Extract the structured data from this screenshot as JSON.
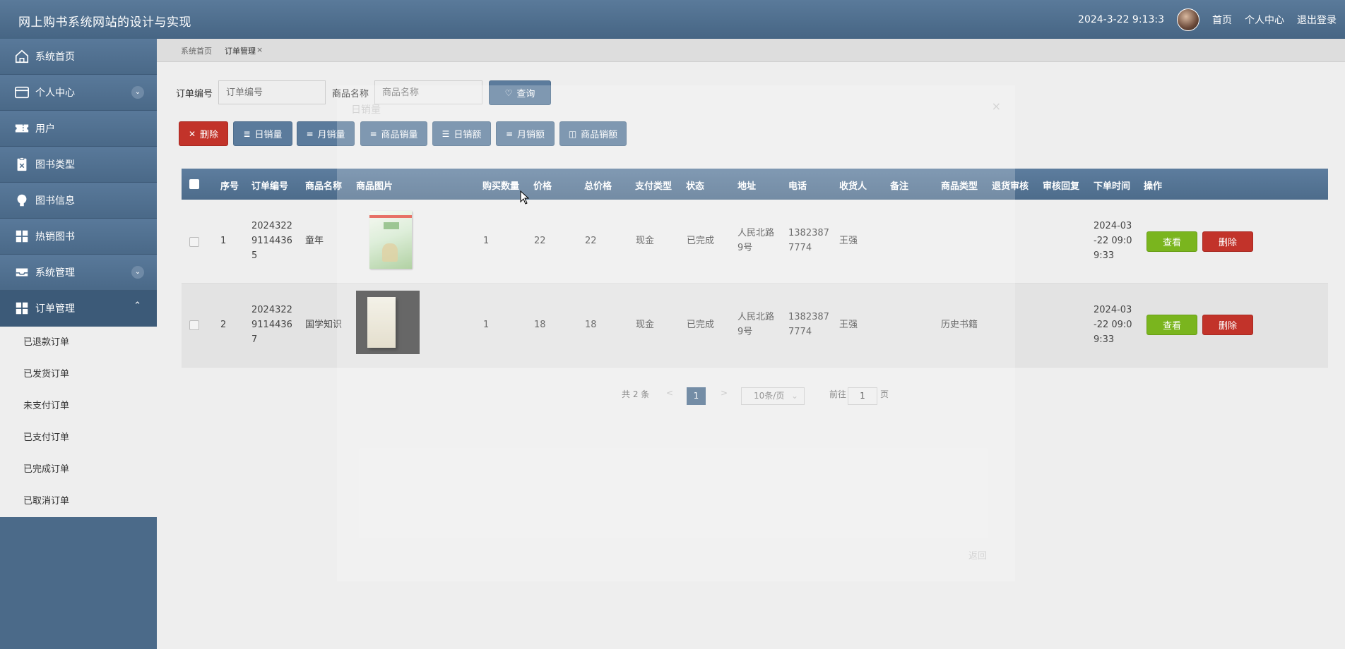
{
  "header": {
    "title": "网上购书系统网站的设计与实现",
    "datetime": "2024-3-22 9:13:3",
    "links": [
      "首页",
      "个人中心",
      "退出登录"
    ]
  },
  "sidebar": {
    "items": [
      {
        "label": "系统首页",
        "icon": "home-icon"
      },
      {
        "label": "个人中心",
        "icon": "card-icon",
        "expandable": true
      },
      {
        "label": "用户",
        "icon": "ticket-icon"
      },
      {
        "label": "图书类型",
        "icon": "clipboard-icon"
      },
      {
        "label": "图书信息",
        "icon": "bulb-icon"
      },
      {
        "label": "热销图书",
        "icon": "grid-icon"
      },
      {
        "label": "系统管理",
        "icon": "tray-icon",
        "expandable": true
      },
      {
        "label": "订单管理",
        "icon": "grid-icon",
        "expanded": true
      }
    ],
    "submenu": [
      "已退款订单",
      "已发货订单",
      "未支付订单",
      "已支付订单",
      "已完成订单",
      "已取消订单"
    ]
  },
  "tabs": [
    "系统首页",
    "订单管理",
    "×"
  ],
  "search": {
    "order_no_label": "订单编号",
    "order_no_placeholder": "订单编号",
    "product_name_label": "商品名称",
    "product_name_placeholder": "商品名称",
    "query_label": "查询"
  },
  "actions": {
    "delete": "删除",
    "daily_sales_qty": "日销量",
    "monthly_sales_qty": "月销量",
    "product_sales_qty": "商品销量",
    "daily_sales_amt": "日销额",
    "monthly_sales_amt": "月销额",
    "product_sales_amt": "商品销额"
  },
  "table": {
    "headers": [
      "序号",
      "订单编号",
      "商品名称",
      "商品图片",
      "购买数量",
      "价格",
      "总价格",
      "支付类型",
      "状态",
      "地址",
      "电话",
      "收货人",
      "备注",
      "商品类型",
      "退货审核",
      "审核回复",
      "下单时间",
      "操作"
    ],
    "rows": [
      {
        "index": "1",
        "order_no": [
          "2024322",
          "9114436",
          "5"
        ],
        "name": "童年",
        "qty": "1",
        "price": "22",
        "total": "22",
        "pay": "现金",
        "status": "已完成",
        "address": [
          "人民北路",
          "9号"
        ],
        "phone": [
          "1382387",
          "7774"
        ],
        "receiver": "王强",
        "remark": "",
        "category": "",
        "return_review": "",
        "review_reply": "",
        "time": [
          "2024-03",
          "-22 09:0",
          "9:33"
        ]
      },
      {
        "index": "2",
        "order_no": [
          "2024322",
          "9114436",
          "7"
        ],
        "name": "国学知识",
        "qty": "1",
        "price": "18",
        "total": "18",
        "pay": "现金",
        "status": "已完成",
        "address": [
          "人民北路",
          "9号"
        ],
        "phone": [
          "1382387",
          "7774"
        ],
        "receiver": "王强",
        "remark": "",
        "category": "历史书籍",
        "return_review": "",
        "review_reply": "",
        "time": [
          "2024-03",
          "-22 09:0",
          "9:33"
        ]
      }
    ],
    "row_actions": {
      "view": "查看",
      "delete": "删除"
    }
  },
  "pagination": {
    "total": "共 2 条",
    "prev": "<",
    "current": "1",
    "next": ">",
    "page_size": "10条/页",
    "goto_prefix": "前往",
    "goto_value": "1",
    "goto_suffix": "页"
  },
  "dialog": {
    "title": "日销量",
    "close": "×",
    "footer_button": "返回"
  }
}
